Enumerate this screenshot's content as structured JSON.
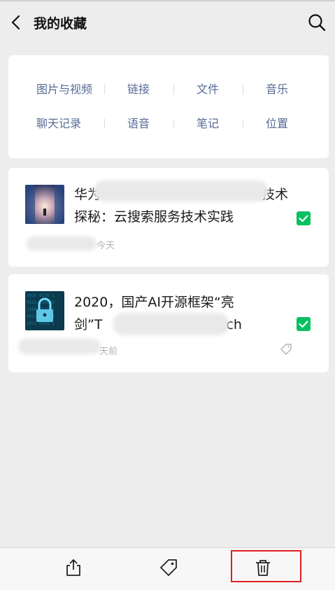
{
  "header": {
    "title": "我的收藏",
    "back_icon": "chevron-left-icon",
    "search_icon": "search-icon"
  },
  "categories": {
    "row1": [
      "图片与视频",
      "链接",
      "文件",
      "音乐"
    ],
    "row2": [
      "聊天记录",
      "语音",
      "笔记",
      "位置"
    ]
  },
  "favorites": [
    {
      "title_line1": "华为",
      "title_line1_end": "技术",
      "title_line2": "探秘：云搜索服务技术实践",
      "meta_time": "今天",
      "checked": true
    },
    {
      "title_line1": "2020，国产AI开源框架“亮",
      "title_line2_start": "剑”T",
      "title_line2_end": "rch",
      "meta_time": "天前",
      "checked": true
    }
  ],
  "toolbar": {
    "icons": [
      "share-icon",
      "tag-icon",
      "trash-icon"
    ]
  },
  "colors": {
    "accent": "#07c160",
    "link": "#576b95",
    "highlight": "#e02020"
  }
}
